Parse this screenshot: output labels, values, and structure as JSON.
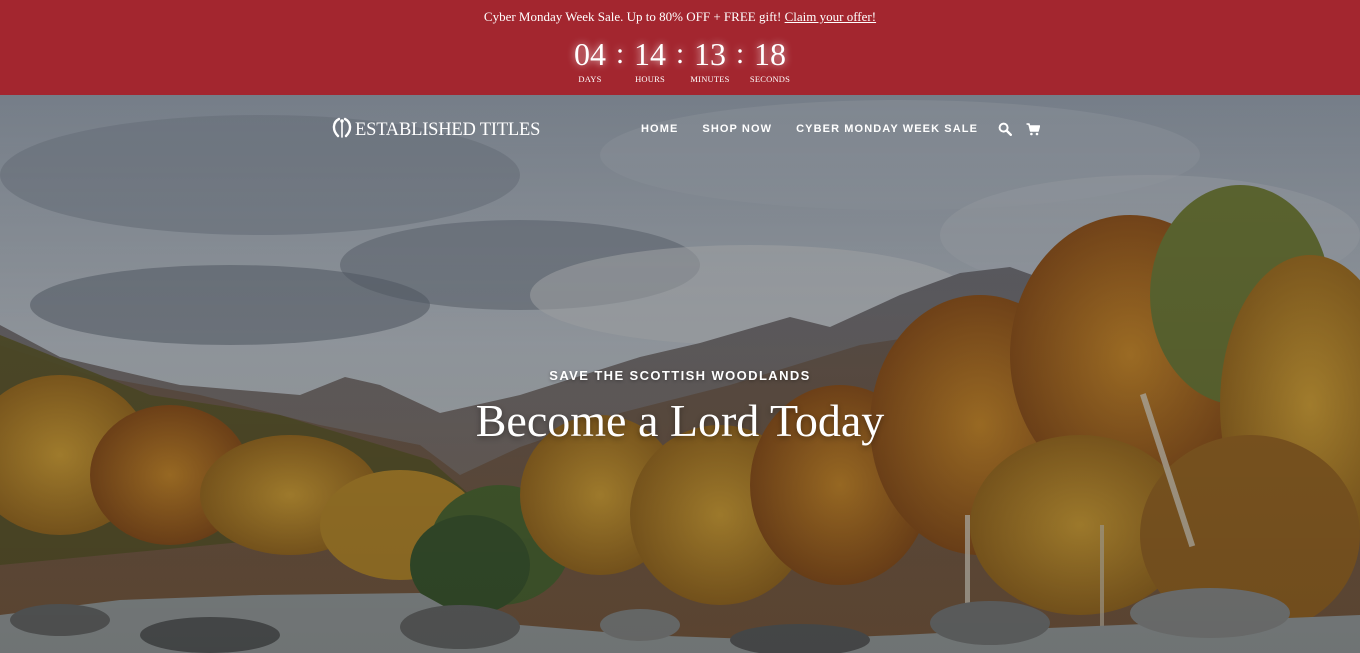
{
  "promo": {
    "text": "Cyber Monday Week Sale. Up to 80% OFF + FREE gift!",
    "link_label": "Claim your offer!",
    "background_color": "#a3262f"
  },
  "countdown": {
    "days": "04",
    "hours": "14",
    "minutes": "13",
    "seconds": "18",
    "separator": ":",
    "labels": {
      "days": "DAYS",
      "hours": "HOURS",
      "minutes": "MINUTES",
      "seconds": "SECONDS"
    }
  },
  "header": {
    "logo_text": "ESTABLISHED TITLES",
    "logo_icon": "laurel-wreath-icon",
    "nav": [
      {
        "label": "HOME"
      },
      {
        "label": "SHOP NOW"
      },
      {
        "label": "CYBER MONDAY WEEK SALE"
      }
    ],
    "icons": [
      "search-icon",
      "cart-icon"
    ]
  },
  "hero": {
    "eyebrow": "SAVE THE SCOTTISH WOODLANDS",
    "headline": "Become a Lord Today"
  }
}
